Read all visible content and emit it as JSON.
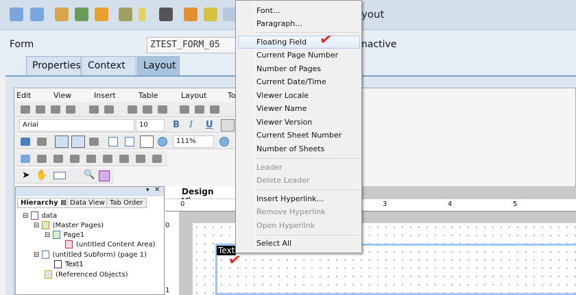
{
  "toolbar": {
    "title_fragment": "yout",
    "icons": [
      "back-arrow",
      "forward-arrow",
      "edit-pencil",
      "activate",
      "copy",
      "hierarchy",
      "wizard",
      "form-preview",
      "org-chart",
      "stack",
      "table"
    ]
  },
  "form": {
    "label": "Form",
    "value": "ZTEST_FORM_05",
    "status_fragment": "nactive"
  },
  "tabs": [
    {
      "label": "Properties"
    },
    {
      "label": "Context"
    },
    {
      "label": "Layout",
      "active": true
    }
  ],
  "designer_menu": [
    "Edit",
    "View",
    "Insert",
    "Table",
    "Layout",
    "To"
  ],
  "font": {
    "family": "Arial",
    "size": "10",
    "zoom": "111%"
  },
  "formatting": {
    "bold": "B",
    "italic": "I",
    "underline": "U"
  },
  "palette": {
    "tabs": [
      "Hierarchy",
      "Data View",
      "Tab Order"
    ],
    "tree": [
      {
        "label": "data",
        "level": 0
      },
      {
        "label": "(Master Pages)",
        "level": 1
      },
      {
        "label": "Page1",
        "level": 2
      },
      {
        "label": "(untitled Content Area)",
        "level": 3
      },
      {
        "label": "(untitled Subform) (page 1)",
        "level": 1
      },
      {
        "label": "Text1",
        "level": 2
      },
      {
        "label": "(Referenced Objects)",
        "level": 1
      }
    ]
  },
  "design_view": {
    "tab": "Design View",
    "ruler_top": [
      "0",
      "3",
      "4",
      "5"
    ],
    "ruler_left": [
      "0",
      "1"
    ],
    "field_label": "Text"
  },
  "context_menu": {
    "items": [
      {
        "label": "Font...",
        "enabled": true
      },
      {
        "label": "Paragraph...",
        "enabled": true
      },
      {
        "label": "Floating Field",
        "enabled": true,
        "highlighted": true
      },
      {
        "label": "Current Page Number",
        "enabled": true
      },
      {
        "label": "Number of Pages",
        "enabled": true
      },
      {
        "label": "Current Date/Time",
        "enabled": true
      },
      {
        "label": "Viewer Locale",
        "enabled": true
      },
      {
        "label": "Viewer Name",
        "enabled": true
      },
      {
        "label": "Viewer Version",
        "enabled": true
      },
      {
        "label": "Current Sheet Number",
        "enabled": true
      },
      {
        "label": "Number of Sheets",
        "enabled": true
      },
      {
        "label": "Leader",
        "enabled": false
      },
      {
        "label": "Delete Leader",
        "enabled": false
      },
      {
        "label": "Insert Hyperlink...",
        "enabled": true
      },
      {
        "label": "Remove Hyperlink",
        "enabled": false
      },
      {
        "label": "Open Hyperlink",
        "enabled": false
      },
      {
        "label": "Select All",
        "enabled": true
      }
    ]
  },
  "annotation_color": "#e03030"
}
